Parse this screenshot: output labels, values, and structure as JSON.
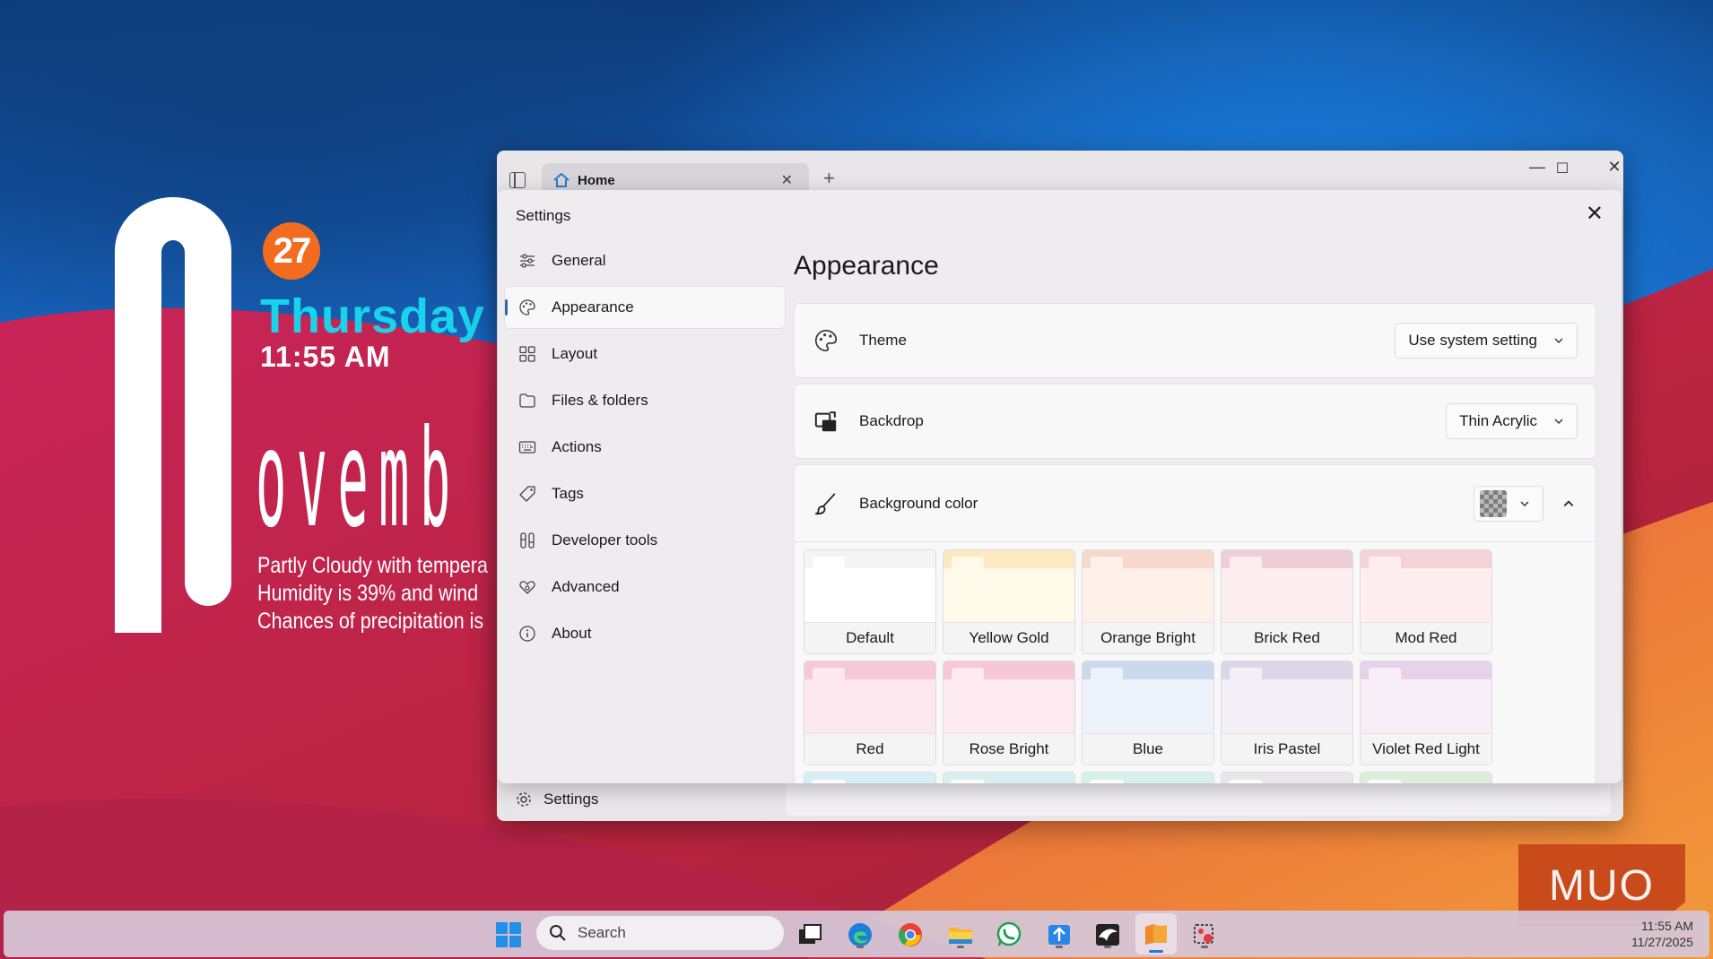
{
  "widget": {
    "day_number": "27",
    "weekday": "Thursday",
    "time": "11:55 AM",
    "month_fragment": "ovemb",
    "weather_line_1": "Partly Cloudy with tempera",
    "weather_line_2": "Humidity is 39% and wind",
    "weather_line_3": "Chances of precipitation is"
  },
  "app": {
    "tab_label": "Home",
    "tab_close_glyph": "✕",
    "new_tab_glyph": "+",
    "minimize_glyph": "—",
    "maximize_glyph": "☐",
    "close_glyph": "✕",
    "bottom_settings_label": "Settings"
  },
  "dialog": {
    "title": "Settings",
    "close_glyph": "✕",
    "nav": [
      {
        "label": "General",
        "icon": "sliders-icon"
      },
      {
        "label": "Appearance",
        "icon": "palette-icon"
      },
      {
        "label": "Layout",
        "icon": "grid-icon"
      },
      {
        "label": "Files & folders",
        "icon": "folder-icon"
      },
      {
        "label": "Actions",
        "icon": "keyboard-icon"
      },
      {
        "label": "Tags",
        "icon": "tag-icon"
      },
      {
        "label": "Developer tools",
        "icon": "tools-icon"
      },
      {
        "label": "Advanced",
        "icon": "advanced-icon"
      },
      {
        "label": "About",
        "icon": "info-icon"
      }
    ],
    "active_nav": "Appearance",
    "page_title": "Appearance",
    "theme": {
      "label": "Theme",
      "value": "Use system setting"
    },
    "backdrop": {
      "label": "Backdrop",
      "value": "Thin Acrylic"
    },
    "background_color": {
      "label": "Background color"
    },
    "swatches": [
      {
        "label": "Default",
        "color": "#ffffff",
        "top": "#f4f4f4"
      },
      {
        "label": "Yellow Gold",
        "color": "#fff9ea",
        "top": "#fbe9c0"
      },
      {
        "label": "Orange Bright",
        "color": "#fff1ea",
        "top": "#f7d8cc"
      },
      {
        "label": "Brick Red",
        "color": "#fcedf0",
        "top": "#efcfd6"
      },
      {
        "label": "Mod Red",
        "color": "#ffeef0",
        "top": "#f4d2d7"
      },
      {
        "label": "Red",
        "color": "#fde8f0",
        "top": "#f6c8d8"
      },
      {
        "label": "Rose Bright",
        "color": "#fde9f0",
        "top": "#f5c7d7"
      },
      {
        "label": "Blue",
        "color": "#eef3fb",
        "top": "#cbd9ee"
      },
      {
        "label": "Iris Pastel",
        "color": "#f3eff6",
        "top": "#ddd6e8"
      },
      {
        "label": "Violet Red Light",
        "color": "#f8eef8",
        "top": "#e6d2ea"
      }
    ],
    "swatches_partial": [
      "#d6eef4",
      "#d8eff2",
      "#d6f1ea",
      "#e8e6e8",
      "#dbeedb"
    ]
  },
  "taskbar": {
    "search_placeholder": "Search",
    "time": "11:55 AM",
    "date": "11/27/2025"
  },
  "watermark": "MUO"
}
